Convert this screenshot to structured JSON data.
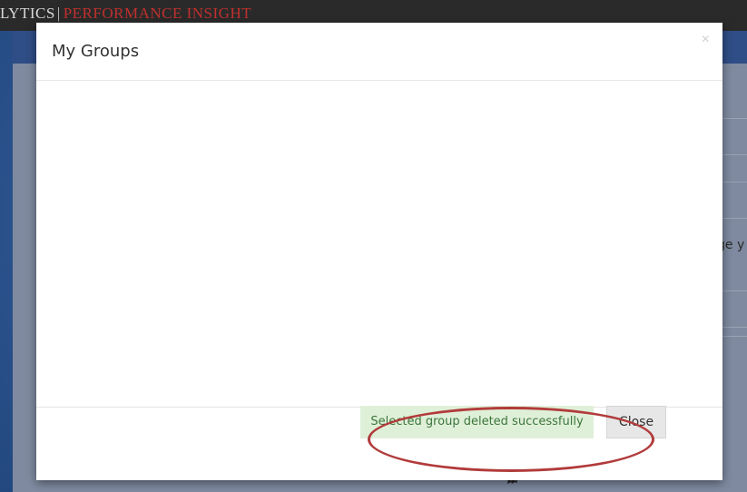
{
  "background_app": {
    "brand_part1": "LYTICS",
    "brand_separator": "|",
    "brand_part2": "PERFORMANCE INSIGHT",
    "partial_text": "ge y",
    "pagination_icon": "last-page-icon"
  },
  "modal": {
    "title": "My Groups",
    "close_icon": "×",
    "alert_message": "Selected group deleted successfully",
    "close_button_label": "Close"
  },
  "colors": {
    "brand_red": "#c0302f",
    "alert_bg": "#dff0d8",
    "alert_text": "#3c763d",
    "highlight_ring": "#b23b3b"
  }
}
